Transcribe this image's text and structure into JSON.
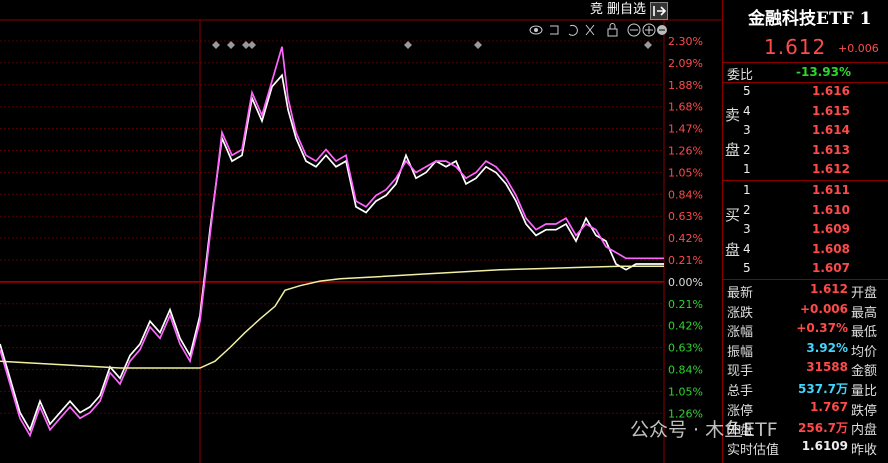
{
  "toolbar": {
    "jing": "竞",
    "remove_watch": "删自选",
    "exit_icon": "exit-icon"
  },
  "chart_data": {
    "type": "line",
    "y_right_labels": [
      "2.30%",
      "2.09%",
      "1.88%",
      "1.68%",
      "1.47%",
      "1.26%",
      "1.05%",
      "0.84%",
      "0.63%",
      "0.42%",
      "0.21%",
      "0.00%",
      "0.21%",
      "0.42%",
      "0.63%",
      "0.84%",
      "1.05%",
      "1.26%"
    ],
    "ylim_percent": [
      -1.3,
      2.35
    ],
    "series": [
      {
        "color": "#ffffff",
        "x": [
          0,
          10,
          20,
          30,
          40,
          50,
          60,
          70,
          80,
          90,
          100,
          110,
          120,
          130,
          140,
          150,
          160,
          170,
          180,
          190,
          200,
          210,
          222,
          232,
          242,
          252,
          262,
          272,
          282,
          288,
          296,
          306,
          316,
          326,
          336,
          346,
          356,
          366,
          376,
          386,
          396,
          406,
          416,
          426,
          436,
          446,
          456,
          466,
          476,
          486,
          496,
          506,
          516,
          526,
          536,
          546,
          556,
          566,
          576,
          586,
          596,
          606,
          616,
          626,
          636,
          646,
          656,
          664
        ],
        "values": [
          -0.35,
          -0.65,
          -0.95,
          -1.1,
          -0.85,
          -1.05,
          -0.95,
          -0.85,
          -0.95,
          -0.9,
          -0.8,
          -0.55,
          -0.65,
          -0.45,
          -0.35,
          -0.15,
          -0.25,
          -0.05,
          -0.3,
          -0.45,
          -0.1,
          0.65,
          1.45,
          1.25,
          1.3,
          1.8,
          1.6,
          1.9,
          2.0,
          1.7,
          1.45,
          1.25,
          1.2,
          1.3,
          1.2,
          1.25,
          0.85,
          0.8,
          0.9,
          0.95,
          1.05,
          1.3,
          1.1,
          1.15,
          1.25,
          1.2,
          1.25,
          1.05,
          1.1,
          1.2,
          1.15,
          1.05,
          0.9,
          0.7,
          0.6,
          0.65,
          0.65,
          0.7,
          0.55,
          0.75,
          0.6,
          0.55,
          0.35,
          0.3,
          0.35,
          0.35,
          0.35,
          0.35
        ]
      },
      {
        "color": "#ff66ff",
        "x": [
          0,
          10,
          20,
          30,
          40,
          50,
          60,
          70,
          80,
          90,
          100,
          110,
          120,
          130,
          140,
          150,
          160,
          170,
          180,
          190,
          200,
          210,
          222,
          232,
          242,
          252,
          262,
          272,
          282,
          288,
          296,
          306,
          316,
          326,
          336,
          346,
          356,
          366,
          376,
          386,
          396,
          406,
          416,
          426,
          436,
          446,
          456,
          466,
          476,
          486,
          496,
          506,
          516,
          526,
          536,
          546,
          556,
          566,
          576,
          586,
          596,
          606,
          616,
          626,
          636,
          646,
          656,
          664
        ],
        "values": [
          -0.4,
          -0.7,
          -1.0,
          -1.15,
          -0.9,
          -1.1,
          -1.0,
          -0.9,
          -1.0,
          -0.95,
          -0.85,
          -0.6,
          -0.7,
          -0.5,
          -0.4,
          -0.2,
          -0.3,
          -0.1,
          -0.35,
          -0.5,
          -0.15,
          0.6,
          1.5,
          1.3,
          1.35,
          1.85,
          1.65,
          1.95,
          2.25,
          1.8,
          1.5,
          1.3,
          1.25,
          1.35,
          1.25,
          1.3,
          0.9,
          0.85,
          0.95,
          1.0,
          1.1,
          1.25,
          1.15,
          1.2,
          1.25,
          1.25,
          1.2,
          1.1,
          1.15,
          1.25,
          1.2,
          1.1,
          0.95,
          0.75,
          0.65,
          0.7,
          0.7,
          0.75,
          0.6,
          0.7,
          0.65,
          0.5,
          0.45,
          0.4,
          0.4,
          0.4,
          0.4,
          0.4
        ]
      },
      {
        "color": "#f0f0a0",
        "x": [
          0,
          40,
          80,
          120,
          160,
          200,
          215,
          230,
          245,
          260,
          275,
          285,
          300,
          320,
          340,
          380,
          420,
          460,
          500,
          540,
          580,
          620,
          664
        ],
        "values": [
          -0.5,
          -0.52,
          -0.54,
          -0.56,
          -0.56,
          -0.56,
          -0.5,
          -0.38,
          -0.25,
          -0.13,
          -0.02,
          0.12,
          0.16,
          0.2,
          0.22,
          0.24,
          0.26,
          0.28,
          0.3,
          0.31,
          0.32,
          0.33,
          0.33
        ]
      }
    ]
  },
  "panel": {
    "title": "金融科技ETF 1",
    "price": "1.612",
    "change": "+0.006",
    "weibi_label": "委比",
    "weibi_value": "-13.93%",
    "sell_label_1": "卖",
    "sell_label_2": "盘",
    "buy_label_1": "买",
    "buy_label_2": "盘",
    "asks": [
      {
        "lvl": "5",
        "price": "1.616"
      },
      {
        "lvl": "4",
        "price": "1.615"
      },
      {
        "lvl": "3",
        "price": "1.614"
      },
      {
        "lvl": "2",
        "price": "1.613"
      },
      {
        "lvl": "1",
        "price": "1.612"
      }
    ],
    "bids": [
      {
        "lvl": "1",
        "price": "1.611"
      },
      {
        "lvl": "2",
        "price": "1.610"
      },
      {
        "lvl": "3",
        "price": "1.609"
      },
      {
        "lvl": "4",
        "price": "1.608"
      },
      {
        "lvl": "5",
        "price": "1.607"
      }
    ],
    "stats": [
      {
        "label": "最新",
        "value": "1.612",
        "color": "red",
        "label2": "开盘"
      },
      {
        "label": "涨跌",
        "value": "+0.006",
        "color": "red",
        "label2": "最高"
      },
      {
        "label": "涨幅",
        "value": "+0.37%",
        "color": "red",
        "label2": "最低"
      },
      {
        "label": "振幅",
        "value": "3.92%",
        "color": "cyan",
        "label2": "均价"
      },
      {
        "label": "现手",
        "value": "31588",
        "color": "red",
        "label2": "金额"
      },
      {
        "label": "总手",
        "value": "537.7万",
        "color": "cyan",
        "label2": "量比"
      },
      {
        "label": "涨停",
        "value": "1.767",
        "color": "red",
        "label2": "跌停"
      },
      {
        "label": "外盘",
        "value": "256.7万",
        "color": "red",
        "label2": "内盘"
      },
      {
        "label": "实时估值",
        "value": "1.6109",
        "color": "white",
        "label2": "昨收"
      }
    ]
  },
  "watermark": "公众号 · 木鱼ETF"
}
